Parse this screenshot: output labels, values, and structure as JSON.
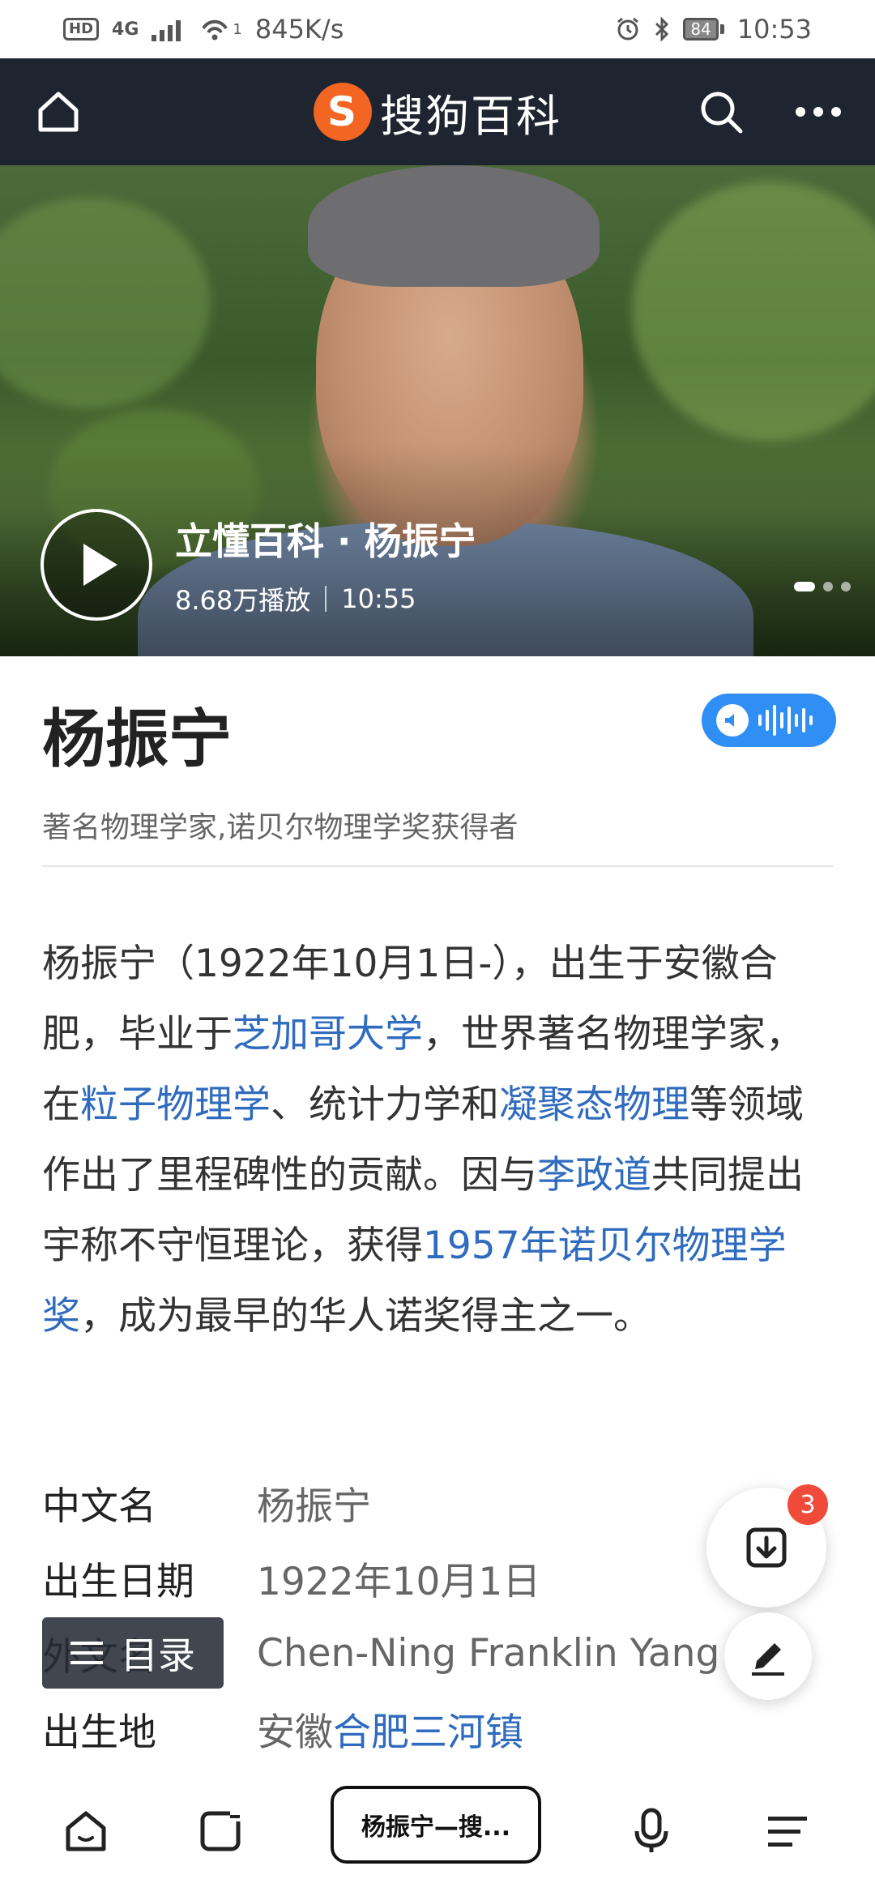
{
  "status_bar": {
    "hd": "HD",
    "network": "4G",
    "wifi_sup": "1",
    "speed": "845K/s",
    "battery": "84",
    "time": "10:53"
  },
  "header": {
    "brand_logo": "S",
    "brand_name": "搜狗百科"
  },
  "hero": {
    "video_title": "立懂百科 · 杨振宁",
    "play_count": "8.68万播放",
    "duration": "10:55",
    "carousel_total": 3,
    "carousel_active": 1
  },
  "entry": {
    "title": "杨振宁",
    "subtitle": "著名物理学家,诺贝尔物理学奖获得者"
  },
  "summary": {
    "t1": "杨振宁（1922年10月1日-），出生于安徽合肥，毕业于",
    "l1": "芝加哥大学",
    "t2": "，世界著名物理学家，在",
    "l2": "粒子物理学",
    "t3": "、统计力学和",
    "l3": "凝聚态物理",
    "t4": "等领域作出了里程碑性的贡献。因与",
    "l4": "李政道",
    "t5": "共同提出宇称不守恒理论，获得",
    "l5": "1957年诺贝尔物理学奖",
    "t6": "，成为最早的华人诺奖得主之一。"
  },
  "info": {
    "rows": [
      {
        "key": "中文名",
        "value": "杨振宁"
      },
      {
        "key": "出生日期",
        "value": "1922年10月1日"
      },
      {
        "key": "外文名",
        "value": "Chen-Ning Franklin Yang"
      }
    ],
    "birthplace_key": "出生地",
    "birthplace_prefix": "安徽",
    "birthplace_link": "合肥三河镇"
  },
  "floating": {
    "toc_label": "目录",
    "download_badge": "3"
  },
  "bottom_bar": {
    "tab_label": "杨振宁—搜..."
  },
  "colors": {
    "header_bg": "#1e2530",
    "brand_orange": "#f26522",
    "link": "#2f6bbf",
    "audio_button": "#2f8ff4",
    "badge_red": "#f04a3a"
  }
}
